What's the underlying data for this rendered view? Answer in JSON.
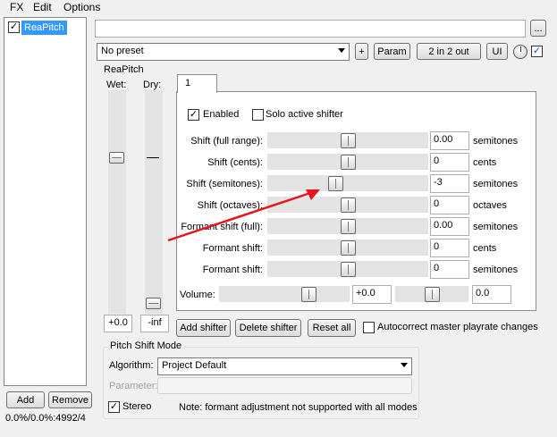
{
  "menu": {
    "items": [
      "FX",
      "Edit",
      "Options"
    ]
  },
  "fx_list": {
    "items": [
      {
        "label": "ReaPitch",
        "checked": true
      }
    ],
    "add_label": "Add",
    "remove_label": "Remove",
    "status": "0.0%/0.0%:4992/4"
  },
  "toolbar": {
    "name_value": "",
    "browse_label": "...",
    "preset": "No preset",
    "plus_label": "+",
    "param_label": "Param",
    "io_label": "2 in 2 out",
    "ui_label": "UI",
    "bypass_checked": true
  },
  "plugin": {
    "title": "ReaPitch",
    "wet_label": "Wet:",
    "dry_label": "Dry:",
    "wet_value": "+0.0",
    "dry_value": "-inf",
    "tab_label": "1",
    "enabled_label": "Enabled",
    "enabled_checked": true,
    "solo_label": "Solo active shifter",
    "solo_checked": false,
    "params": [
      {
        "label": "Shift (full range):",
        "value": "0.00",
        "unit": "semitones",
        "pos": 0.5
      },
      {
        "label": "Shift (cents):",
        "value": "0",
        "unit": "cents",
        "pos": 0.5
      },
      {
        "label": "Shift (semitones):",
        "value": "-3",
        "unit": "semitones",
        "pos": 0.42
      },
      {
        "label": "Shift (octaves):",
        "value": "0",
        "unit": "octaves",
        "pos": 0.5
      },
      {
        "label": "Formant shift (full):",
        "value": "0.00",
        "unit": "semitones",
        "pos": 0.5
      },
      {
        "label": "Formant shift:",
        "value": "0",
        "unit": "cents",
        "pos": 0.5
      },
      {
        "label": "Formant shift:",
        "value": "0",
        "unit": "semitones",
        "pos": 0.5
      }
    ],
    "volume_label": "Volume:",
    "volume_value": "+0.0",
    "pan_value": "0.0",
    "add_shifter_label": "Add shifter",
    "delete_shifter_label": "Delete shifter",
    "reset_all_label": "Reset all",
    "autocorrect_label": "Autocorrect master playrate changes",
    "autocorrect_checked": false,
    "mode_title": "Pitch Shift Mode",
    "algorithm_label": "Algorithm:",
    "algorithm_value": "Project Default",
    "parameter_label": "Parameter:",
    "parameter_value": "",
    "stereo_label": "Stereo",
    "stereo_checked": true,
    "note": "Note: formant adjustment not supported with all modes"
  },
  "colors": {
    "accent": "#3399ff",
    "arrow": "#e8141c"
  }
}
